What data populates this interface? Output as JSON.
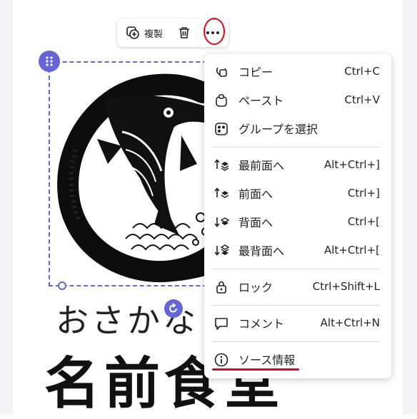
{
  "toolbar": {
    "duplicate_label": "複製",
    "duplicate_icon": "duplicate-icon",
    "delete_icon": "trash-icon",
    "more_icon": "more-horizontal-icon"
  },
  "canvas": {
    "subtitle": "おさかな",
    "title": "名前食堂"
  },
  "context_menu": {
    "items": [
      {
        "label": "コピー",
        "shortcut": "Ctrl+C",
        "icon": "copy-icon"
      },
      {
        "label": "ペースト",
        "shortcut": "Ctrl+V",
        "icon": "paste-icon"
      },
      {
        "label": "グループを選択",
        "shortcut": "",
        "icon": "select-group-icon"
      },
      {
        "label": "最前面へ",
        "shortcut": "Alt+Ctrl+]",
        "icon": "bring-to-front-icon"
      },
      {
        "label": "前面へ",
        "shortcut": "Ctrl+]",
        "icon": "bring-forward-icon"
      },
      {
        "label": "背面へ",
        "shortcut": "Ctrl+[",
        "icon": "send-backward-icon"
      },
      {
        "label": "最背面へ",
        "shortcut": "Alt+Ctrl+[",
        "icon": "send-to-back-icon"
      },
      {
        "label": "ロック",
        "shortcut": "Ctrl+Shift+L",
        "icon": "lock-icon"
      },
      {
        "label": "コメント",
        "shortcut": "Alt+Ctrl+N",
        "icon": "comment-icon"
      },
      {
        "label": "ソース情報",
        "shortcut": "",
        "icon": "info-icon"
      }
    ]
  },
  "colors": {
    "selection": "#6466d8",
    "annotation": "#e60012"
  }
}
